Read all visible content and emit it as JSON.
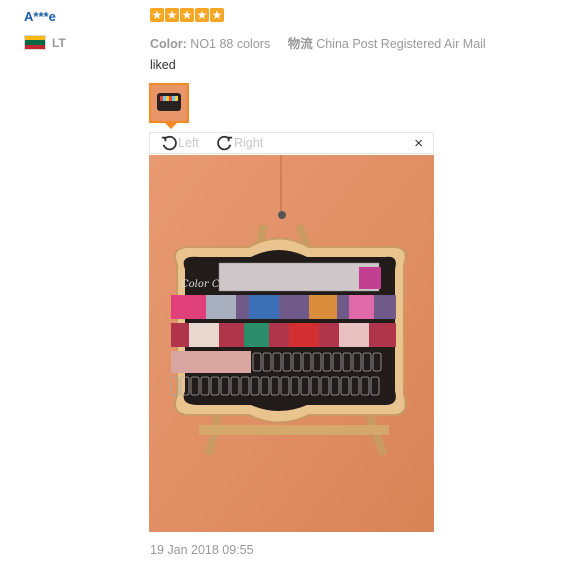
{
  "reviewer": {
    "name": "A***e",
    "country_code": "LT",
    "flag_colors": [
      "#fdb913",
      "#006a44",
      "#c1272d"
    ]
  },
  "rating": {
    "stars": 5,
    "color": "#f5a623"
  },
  "meta": {
    "color_label": "Color:",
    "color_value": "NO1 88 colors",
    "logistics_label": "物流",
    "logistics_value": "China Post Registered Air Mail"
  },
  "feedback_text": "liked",
  "viewer": {
    "rotate_left_label": "Left",
    "rotate_right_label": "Right",
    "close_glyph": "×",
    "photo_board_text": "Color Co"
  },
  "timestamp": "19 Jan 2018 09:55",
  "icons": [
    "rotate-left-icon",
    "rotate-right-icon",
    "close-icon",
    "star-icon",
    "flag-icon"
  ]
}
